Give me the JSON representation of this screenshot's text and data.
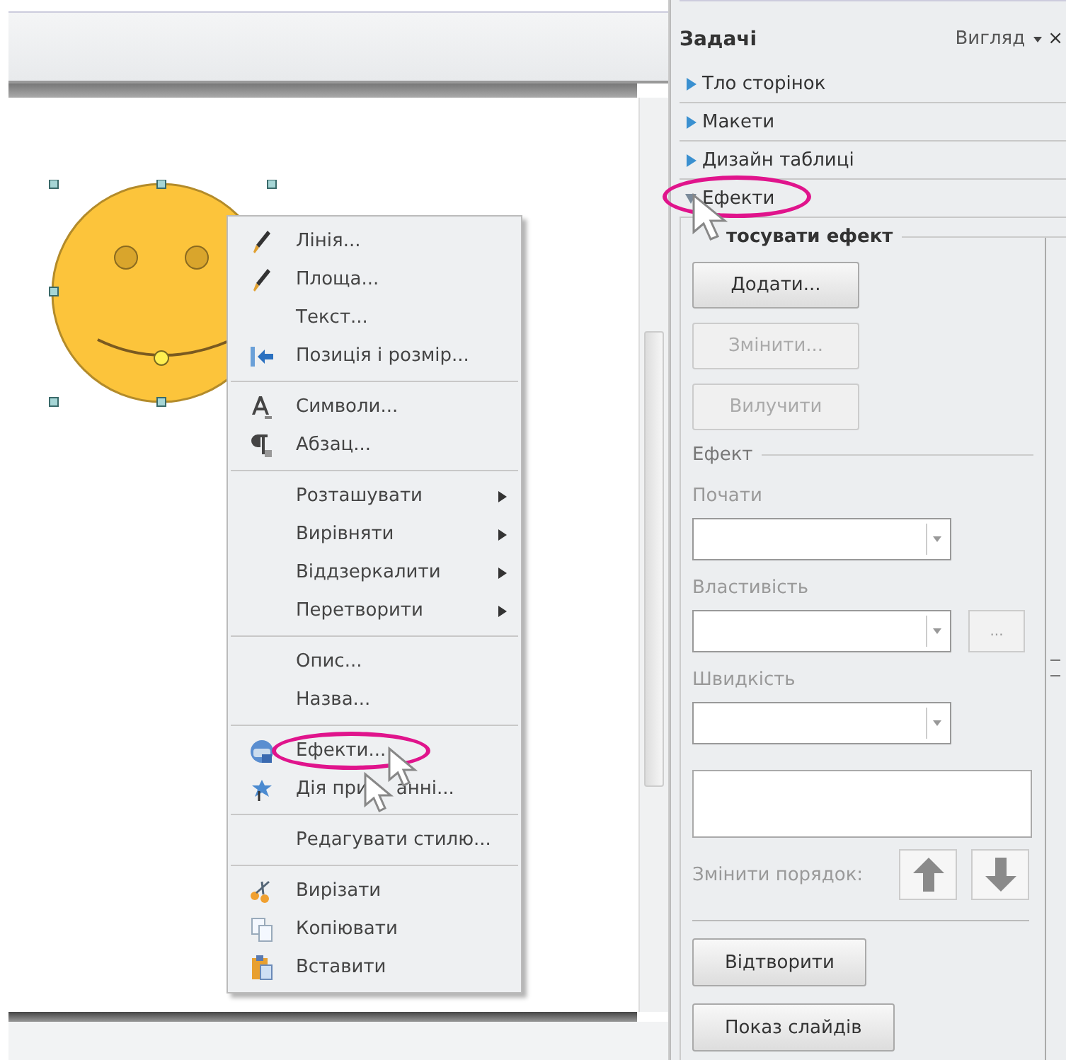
{
  "context_menu": {
    "groups": [
      [
        {
          "label": "Лінія...",
          "submenu": false,
          "highlighted": false
        },
        {
          "label": "Площа...",
          "submenu": false,
          "highlighted": false
        },
        {
          "label": "Текст...",
          "submenu": false,
          "highlighted": false
        },
        {
          "label": "Позиція і розмір...",
          "submenu": false,
          "highlighted": false
        }
      ],
      [
        {
          "label": "Символи...",
          "submenu": false,
          "highlighted": false
        },
        {
          "label": "Абзац...",
          "submenu": false,
          "highlighted": false
        }
      ],
      [
        {
          "label": "Розташувати",
          "submenu": true,
          "highlighted": false
        },
        {
          "label": "Вирівняти",
          "submenu": true,
          "highlighted": false
        },
        {
          "label": "Віддзеркалити",
          "submenu": true,
          "highlighted": false
        },
        {
          "label": "Перетворити",
          "submenu": true,
          "highlighted": false
        }
      ],
      [
        {
          "label": "Опис...",
          "submenu": false,
          "highlighted": false
        },
        {
          "label": "Назва...",
          "submenu": false,
          "highlighted": false
        }
      ],
      [
        {
          "label": "Ефекти...",
          "submenu": false,
          "highlighted": true
        },
        {
          "label": "Дія при",
          "label_after_cursor": "анні...",
          "submenu": false,
          "highlighted": false
        }
      ],
      [
        {
          "label": "Редагувати стилю...",
          "submenu": false,
          "highlighted": false
        }
      ],
      [
        {
          "label": "Вирізати",
          "submenu": false,
          "highlighted": false
        },
        {
          "label": "Копіювати",
          "submenu": false,
          "highlighted": false
        },
        {
          "label": "Вставити",
          "submenu": false,
          "highlighted": false
        }
      ]
    ]
  },
  "task_pane": {
    "title": "Задачі",
    "view_menu": "Вигляд",
    "close": "×",
    "sections": [
      {
        "label": "Тло сторінок",
        "expanded": false,
        "highlighted": false
      },
      {
        "label": "Макети",
        "expanded": false,
        "highlighted": false
      },
      {
        "label": "Дизайн таблиці",
        "expanded": false,
        "highlighted": false
      },
      {
        "label": "Ефекти",
        "expanded": true,
        "highlighted": true
      }
    ],
    "apply_heading": "тосувати ефект",
    "action_buttons": [
      {
        "label": "Додати...",
        "disabled": false
      },
      {
        "label": "Змінити...",
        "disabled": true
      },
      {
        "label": "Вилучити",
        "disabled": true
      }
    ],
    "effect_heading": "Ефект",
    "fields": [
      {
        "label": "Почати",
        "disabled": true
      },
      {
        "label": "Властивість",
        "disabled": true,
        "options_button": "..."
      },
      {
        "label": "Швидкість",
        "disabled": true
      }
    ],
    "reorder_label": "Змінити порядок:",
    "reorder_disabled": true,
    "bottom_buttons": [
      {
        "label": "Відтворити",
        "disabled": false
      },
      {
        "label": "Показ слайдів",
        "disabled": false
      }
    ]
  }
}
